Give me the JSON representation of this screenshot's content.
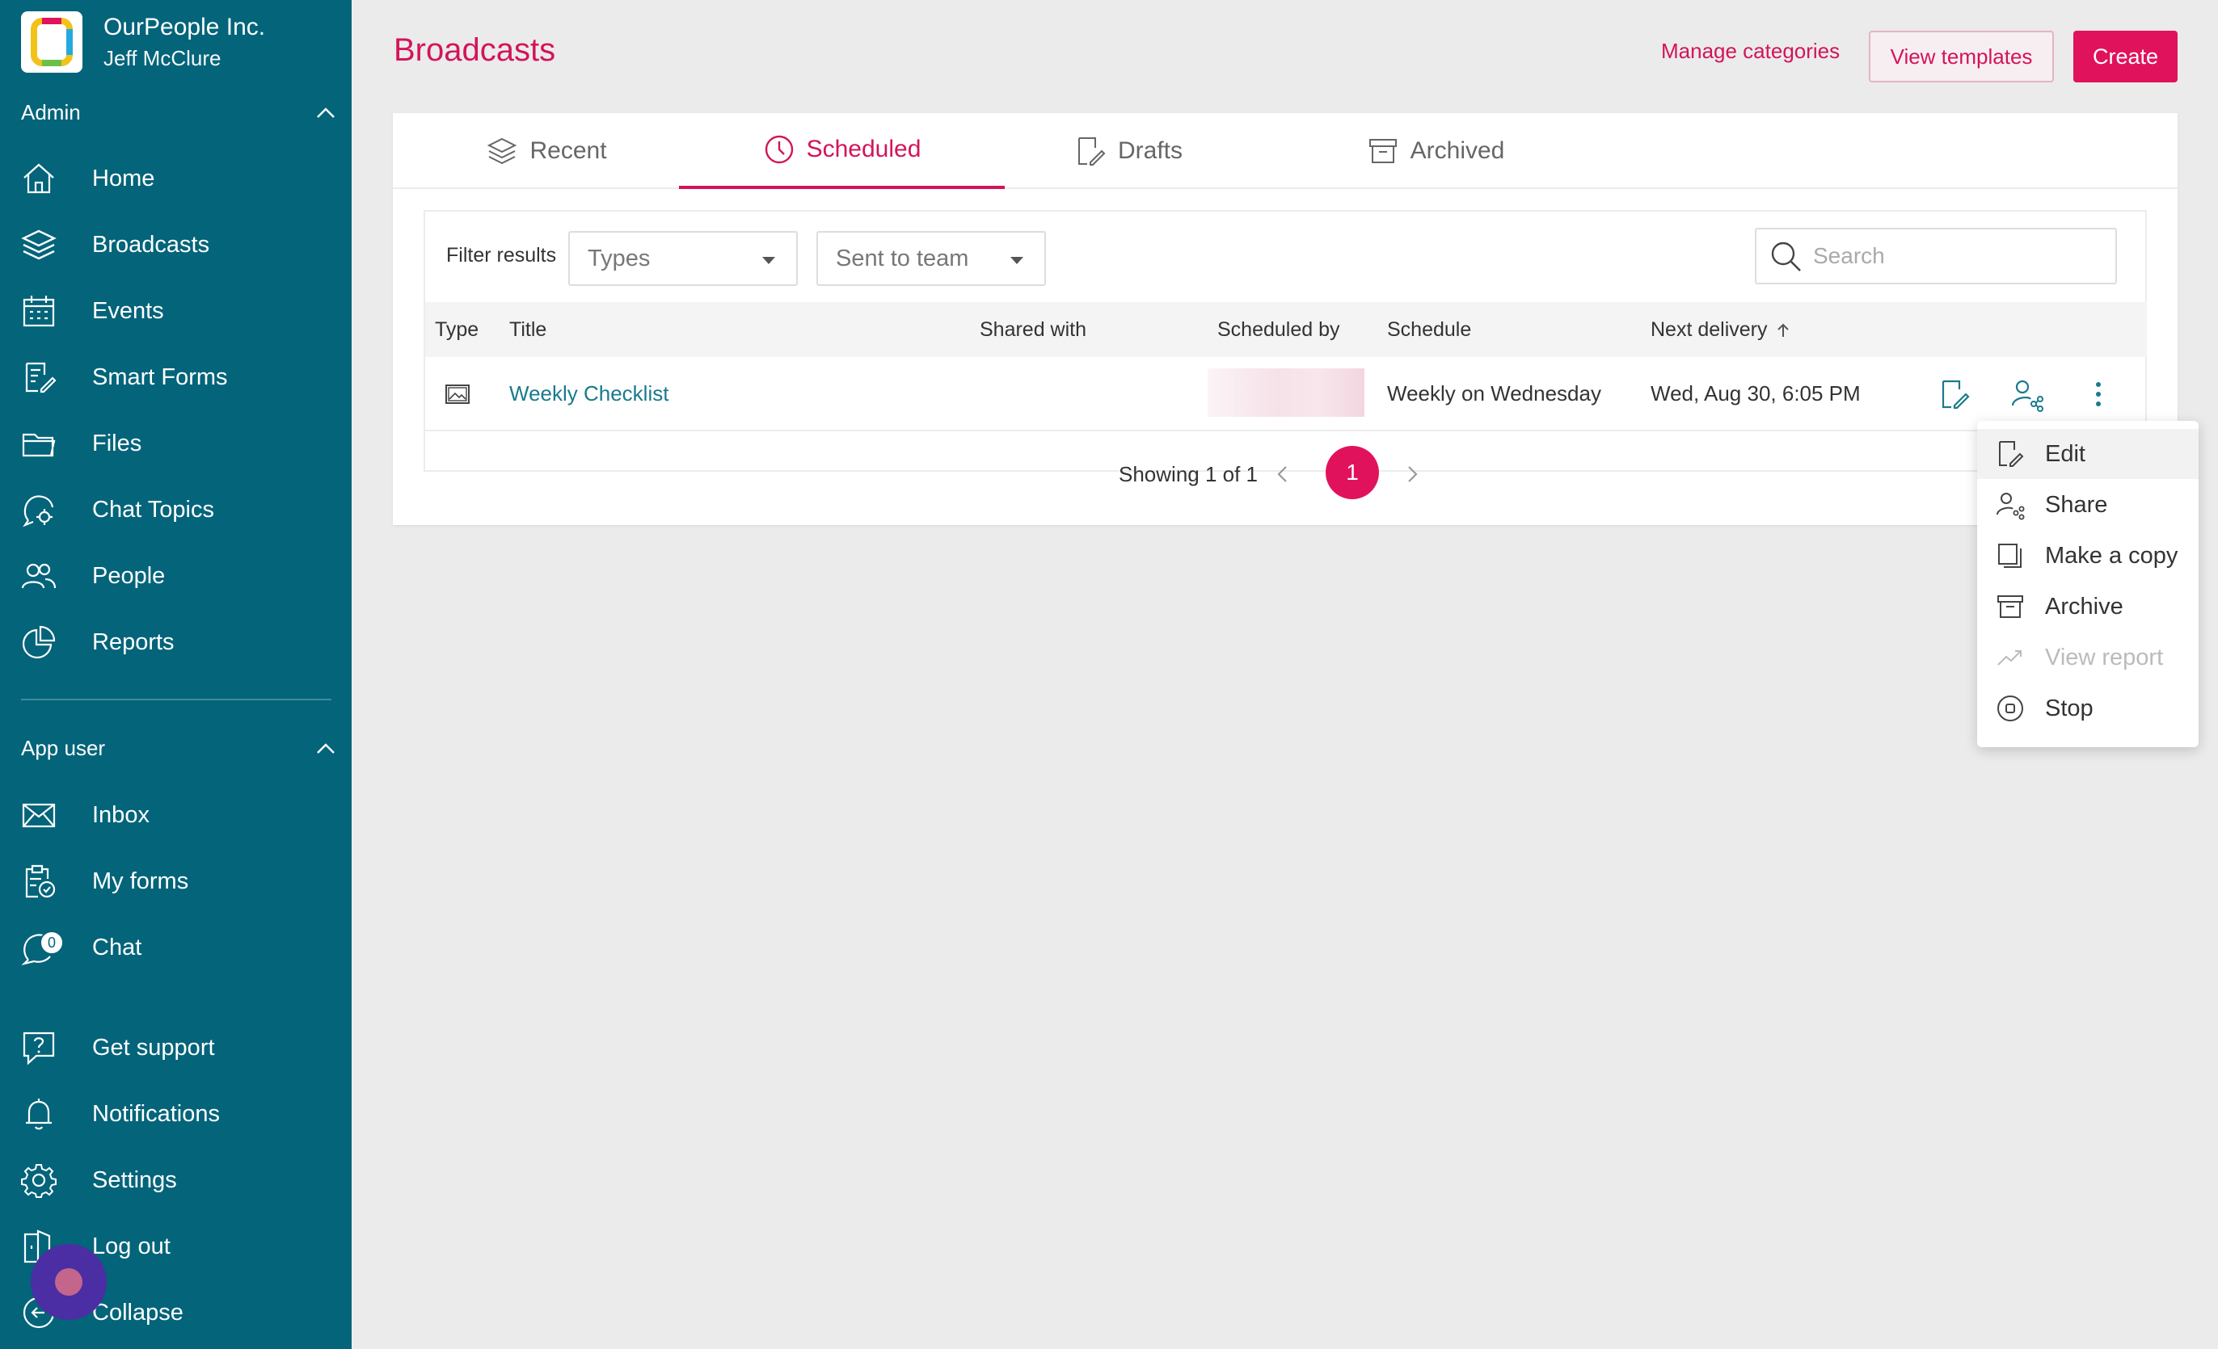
{
  "brand": {
    "org": "OurPeople Inc.",
    "user": "Jeff McClure"
  },
  "sidebar": {
    "admin_label": "Admin",
    "admin_items": [
      {
        "label": "Home",
        "icon": "home-icon"
      },
      {
        "label": "Broadcasts",
        "icon": "layers-icon"
      },
      {
        "label": "Events",
        "icon": "calendar-icon"
      },
      {
        "label": "Smart Forms",
        "icon": "form-icon"
      },
      {
        "label": "Files",
        "icon": "folder-icon"
      },
      {
        "label": "Chat Topics",
        "icon": "chat-topics-icon"
      },
      {
        "label": "People",
        "icon": "people-icon"
      },
      {
        "label": "Reports",
        "icon": "pie-chart-icon"
      }
    ],
    "app_user_label": "App user",
    "app_user_items": [
      {
        "label": "Inbox",
        "icon": "mail-icon"
      },
      {
        "label": "My forms",
        "icon": "clipboard-check-icon"
      },
      {
        "label": "Chat",
        "icon": "chat-icon",
        "badge": "0"
      }
    ],
    "bottom_items": [
      {
        "label": "Get support",
        "icon": "help-icon"
      },
      {
        "label": "Notifications",
        "icon": "bell-icon"
      },
      {
        "label": "Settings",
        "icon": "gear-icon"
      },
      {
        "label": "Log out",
        "icon": "logout-icon"
      },
      {
        "label": "Collapse",
        "icon": "collapse-icon"
      }
    ]
  },
  "header": {
    "title": "Broadcasts",
    "manage_categories": "Manage categories",
    "view_templates": "View templates",
    "create": "Create"
  },
  "tabs": [
    {
      "label": "Recent",
      "icon": "layers-icon",
      "active": false
    },
    {
      "label": "Scheduled",
      "icon": "clock-icon",
      "active": true
    },
    {
      "label": "Drafts",
      "icon": "draft-icon",
      "active": false
    },
    {
      "label": "Archived",
      "icon": "archive-icon",
      "active": false
    }
  ],
  "filters": {
    "label": "Filter results",
    "types_value": "Types",
    "team_value": "Sent to team",
    "search_placeholder": "Search"
  },
  "table": {
    "columns": [
      "Type",
      "Title",
      "Shared with",
      "Scheduled by",
      "Schedule",
      "Next delivery"
    ],
    "sort_column": "Next delivery",
    "sort_direction": "ascending",
    "rows": [
      {
        "type_icon": "image-icon",
        "title": "Weekly Checklist",
        "shared_with": "",
        "scheduled_by": "",
        "schedule": "Weekly on Wednesday",
        "next_delivery": "Wed, Aug 30, 6:05 PM"
      }
    ]
  },
  "pagination": {
    "text": "Showing 1 of 1",
    "current": "1"
  },
  "row_menu": {
    "items": [
      {
        "label": "Edit",
        "icon": "edit-icon",
        "disabled": false
      },
      {
        "label": "Share",
        "icon": "share-icon",
        "disabled": false
      },
      {
        "label": "Make a copy",
        "icon": "copy-icon",
        "disabled": false
      },
      {
        "label": "Archive",
        "icon": "archive-icon",
        "disabled": false
      },
      {
        "label": "View report",
        "icon": "trend-icon",
        "disabled": true
      },
      {
        "label": "Stop",
        "icon": "stop-icon",
        "disabled": false
      }
    ]
  },
  "colors": {
    "sidebar": "#03647a",
    "accent": "#e1125c",
    "link": "#1a7a8c"
  }
}
